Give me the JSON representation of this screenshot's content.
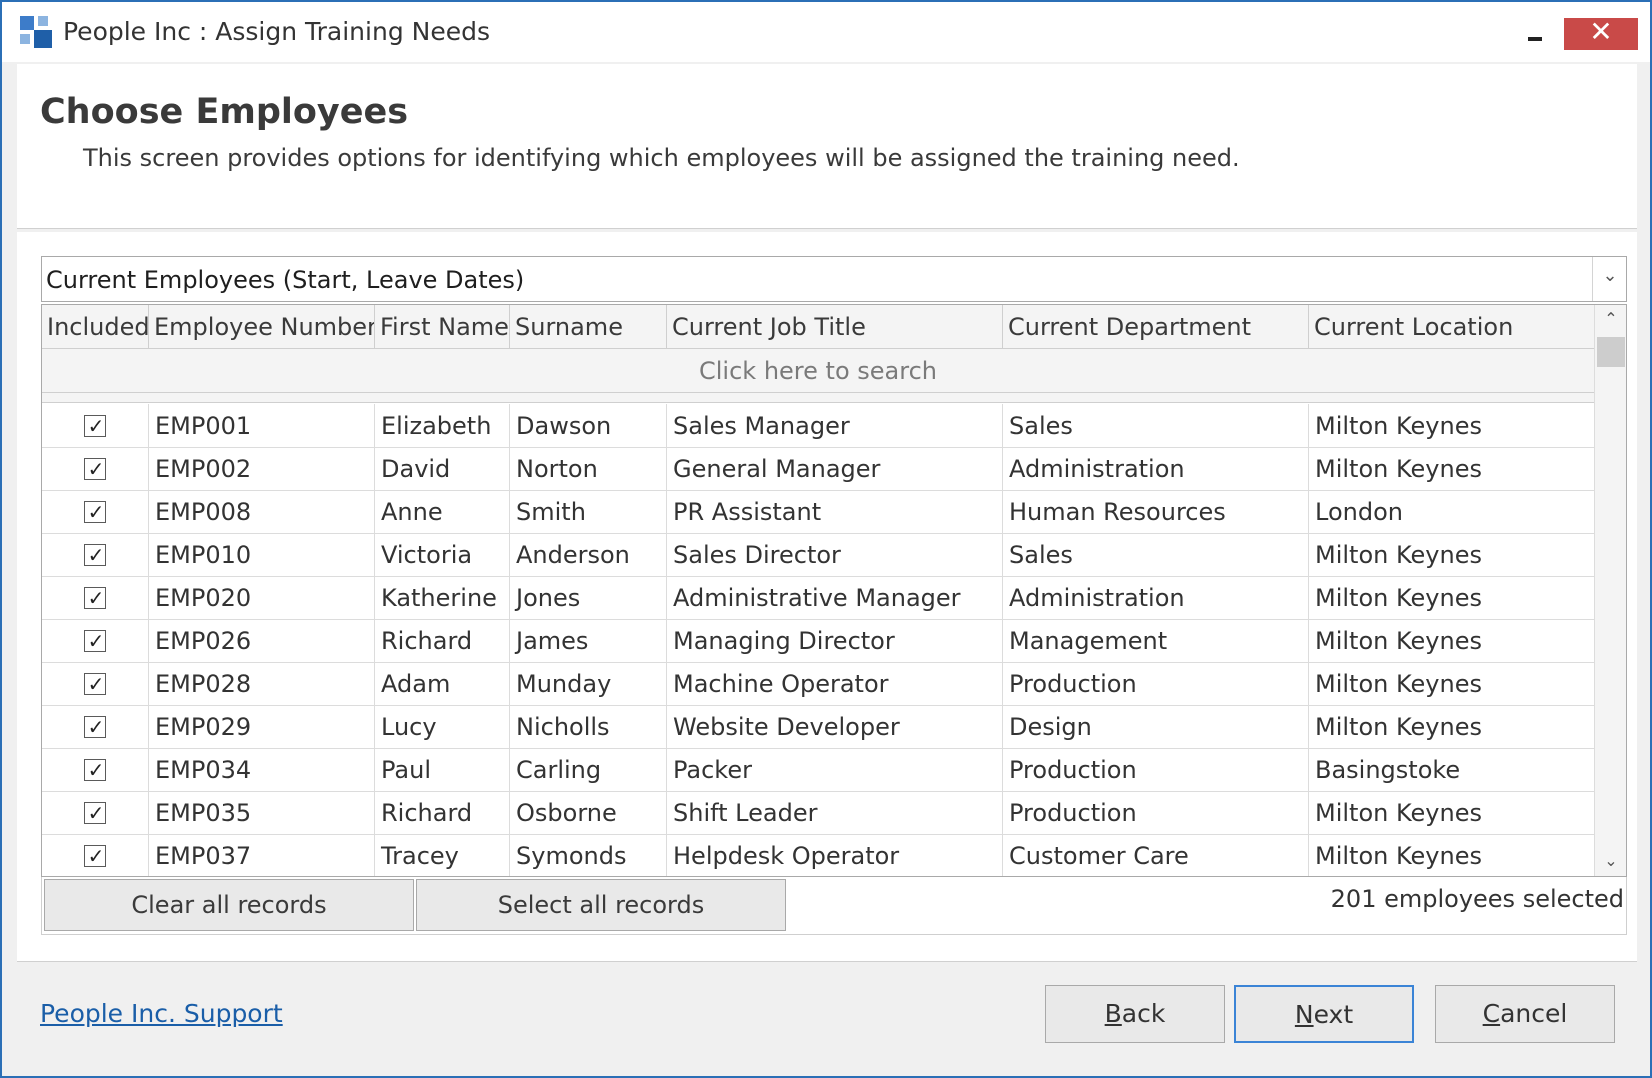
{
  "window": {
    "title": "People Inc : Assign Training Needs",
    "minimize_glyph": "minimize-icon",
    "close_glyph": "✕"
  },
  "header": {
    "title": "Choose Employees",
    "description": "This screen provides options for identifying which employees will be assigned the training need."
  },
  "filter": {
    "selected": "Current Employees (Start, Leave Dates)",
    "arrow": "⌄"
  },
  "grid": {
    "columns": [
      "Included",
      "Employee Number",
      "First Name",
      "Surname",
      "Current Job Title",
      "Current Department",
      "Current Location"
    ],
    "search_placeholder": "Click here to search",
    "check_glyph": "✓",
    "rows": [
      [
        "EMP001",
        "Elizabeth",
        "Dawson",
        "Sales Manager",
        "Sales",
        "Milton Keynes"
      ],
      [
        "EMP002",
        "David",
        "Norton",
        "General Manager",
        "Administration",
        "Milton Keynes"
      ],
      [
        "EMP008",
        "Anne",
        "Smith",
        "PR Assistant",
        "Human Resources",
        "London"
      ],
      [
        "EMP010",
        "Victoria",
        "Anderson",
        "Sales Director",
        "Sales",
        "Milton Keynes"
      ],
      [
        "EMP020",
        "Katherine",
        "Jones",
        "Administrative Manager",
        "Administration",
        "Milton Keynes"
      ],
      [
        "EMP026",
        "Richard",
        "James",
        "Managing Director",
        "Management",
        "Milton Keynes"
      ],
      [
        "EMP028",
        "Adam",
        "Munday",
        "Machine Operator",
        "Production",
        "Milton Keynes"
      ],
      [
        "EMP029",
        "Lucy",
        "Nicholls",
        "Website Developer",
        "Design",
        "Milton Keynes"
      ],
      [
        "EMP034",
        "Paul",
        "Carling",
        "Packer",
        "Production",
        "Basingstoke"
      ],
      [
        "EMP035",
        "Richard",
        "Osborne",
        "Shift Leader",
        "Production",
        "Milton Keynes"
      ],
      [
        "EMP037",
        "Tracey",
        "Symonds",
        "Helpdesk Operator",
        "Customer Care",
        "Milton Keynes"
      ]
    ],
    "scroll_up": "⌃",
    "scroll_down": "⌄"
  },
  "grid_footer": {
    "clear_label": "Clear all records",
    "select_label": "Select all records",
    "count_text": "201 employees selected"
  },
  "bottom": {
    "support_link": "People Inc. Support",
    "back_first": "B",
    "back_rest": "ack",
    "next_first": "N",
    "next_rest": "ext",
    "cancel_first": "C",
    "cancel_rest": "ancel"
  },
  "colors": {
    "accent": "#2b6fb6",
    "close": "#c94a48",
    "link": "#1a5ea8"
  }
}
